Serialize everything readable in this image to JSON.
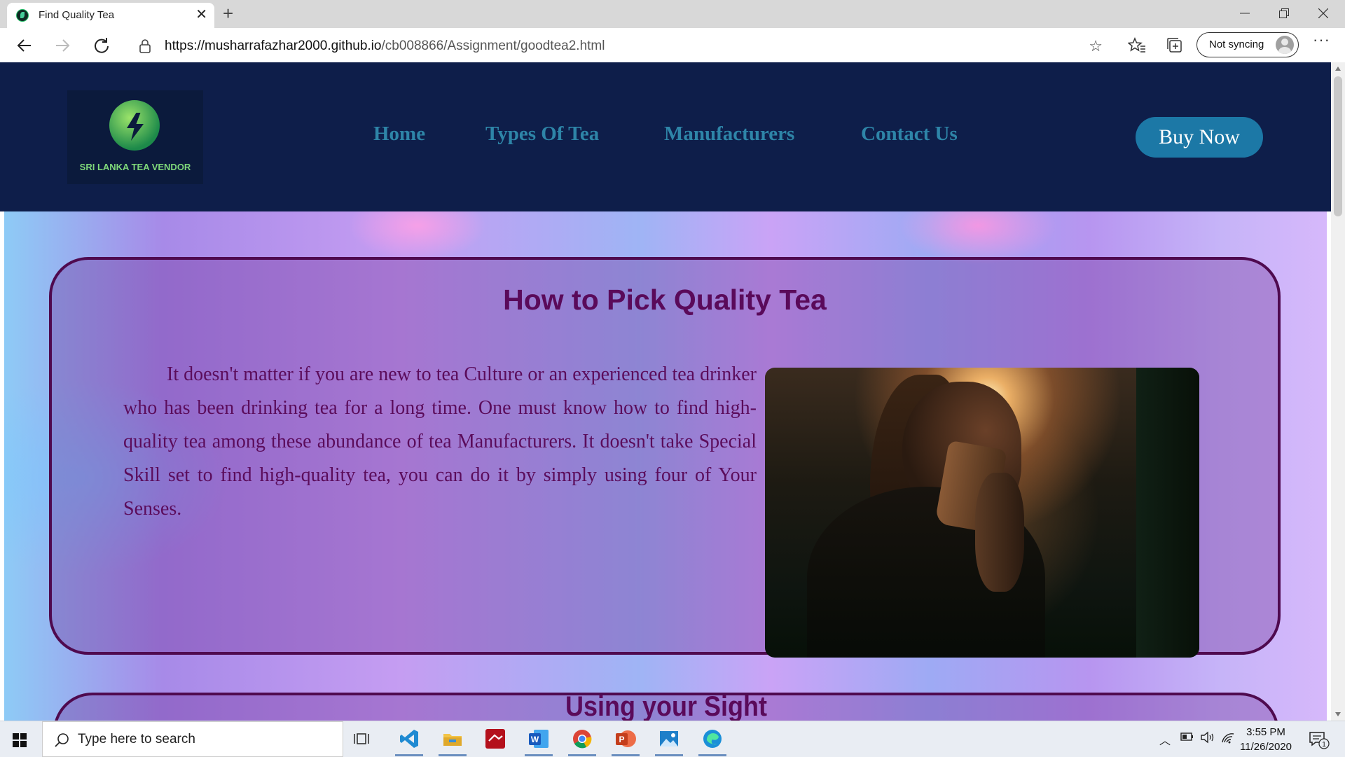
{
  "browser": {
    "tab_title": "Find Quality Tea",
    "url_domain": "https://musharrafazhar2000.github.io",
    "url_path": "/cb008866/Assignment/goodtea2.html",
    "sync_label": "Not syncing"
  },
  "site": {
    "logo_text": "SRI LANKA TEA VENDOR",
    "nav": [
      "Home",
      "Types Of Tea",
      "Manufacturers",
      "Contact Us"
    ],
    "buy_label": "Buy Now",
    "colors": {
      "header": "#0e1e4a",
      "nav_link": "#2e85a8",
      "button": "#1c78a6",
      "heading": "#5a0a5a"
    }
  },
  "section1": {
    "title": "How to Pick Quality Tea",
    "body": "It doesn't matter if you are new to tea Culture or an experienced tea drinker who has been drinking tea for a long time. One must know how to find high-quality tea among these abundance of tea Manufacturers. It doesn't take Special Skill set to find high-quality tea, you can do it by simply using four of Your Senses."
  },
  "section2": {
    "title": "Using your Sight"
  },
  "taskbar": {
    "search_placeholder": "Type here to search",
    "time": "3:55 PM",
    "date": "11/26/2020",
    "notification_count": "1",
    "apps": [
      "task-view",
      "vscode",
      "file-explorer",
      "filezilla",
      "word",
      "chrome",
      "powerpoint",
      "photos",
      "edge"
    ]
  }
}
